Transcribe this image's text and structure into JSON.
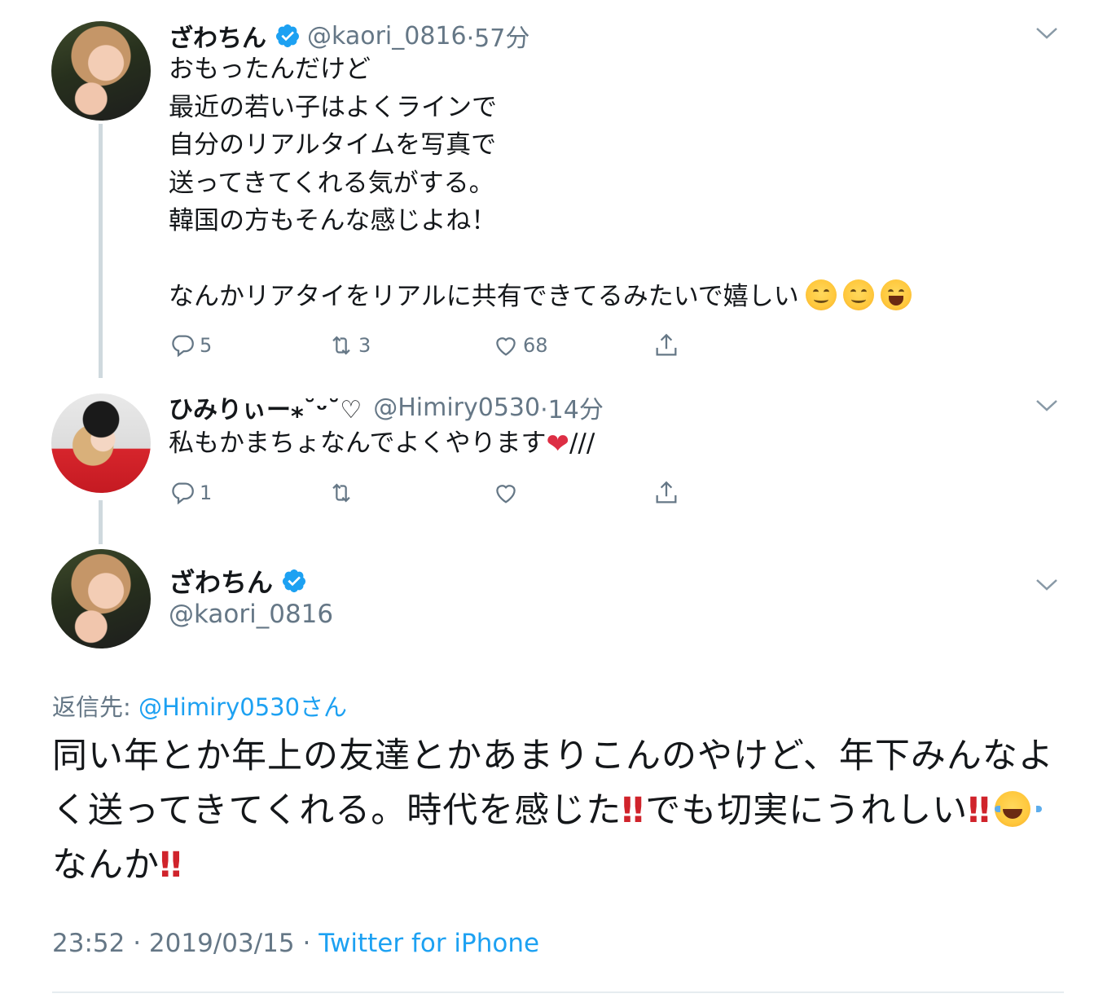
{
  "tweets": [
    {
      "display_name": "ざわちん",
      "handle": "@kaori_0816",
      "time": "·57分",
      "verified": true,
      "lines": [
        "おもったんだけど",
        "最近の若い子はよくラインで",
        "自分のリアルタイムを写真で",
        "送ってきてくれる気がする。",
        "韓国の方もそんな感じよね！",
        "",
        "なんかリアタイをリアルに共有できてるみたいで嬉しい"
      ],
      "emojis": [
        "smiling-face-emoji",
        "smiling-face-emoji",
        "grinning-squinting-face-emoji"
      ],
      "reply_count": "5",
      "retweet_count": "3",
      "like_count": "68"
    },
    {
      "display_name": "ひみりぃー⁎˘ᵕ˘♡",
      "handle": "@Himiry0530",
      "time": "·14分",
      "verified": false,
      "text": "私もかまちょなんでよくやります",
      "text_suffix": "///",
      "reply_count": "1",
      "retweet_count": "",
      "like_count": ""
    }
  ],
  "focused_tweet": {
    "display_name": "ざわちん",
    "handle": "@kaori_0816",
    "verified": true,
    "reply_label": "返信先:",
    "reply_mention": "@Himiry0530さん",
    "text_part1": "同い年とか年上の友達とかあまりこんのやけど、年下みんなよく送ってきてくれる。時代を感じた",
    "bang": "‼",
    "text_part2": "でも切実にうれしい",
    "text_part3": "なんか",
    "time": "23:52",
    "date": "2019/03/15",
    "separator": "·",
    "source": "Twitter for iPhone"
  },
  "colors": {
    "text": "#14171a",
    "secondary": "#657786",
    "link": "#1da1f2",
    "verified": "#1da1f2",
    "thread_line": "#cfd9de"
  }
}
